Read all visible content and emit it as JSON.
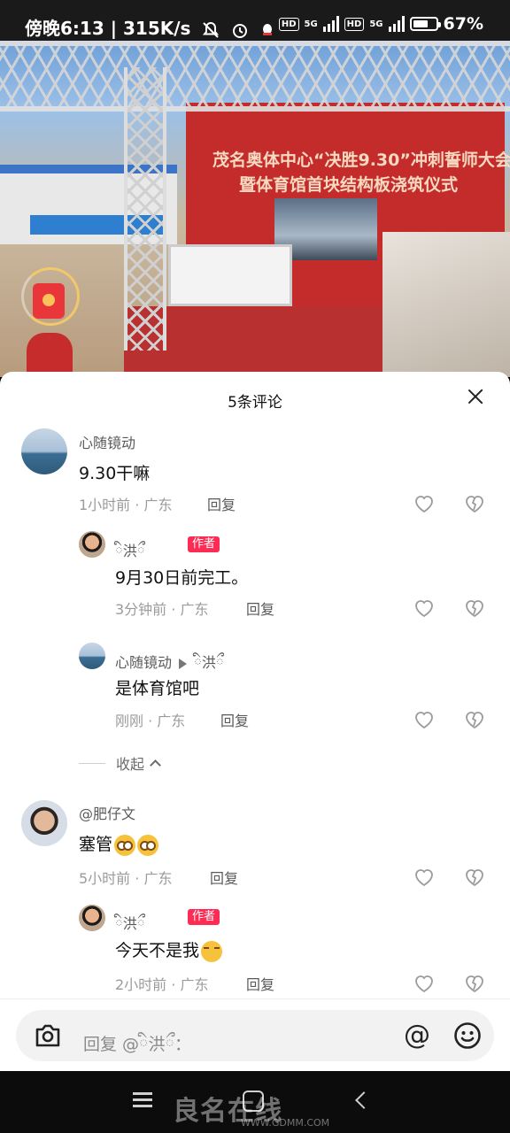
{
  "status_bar": {
    "time": "傍晚6:13",
    "speed": "315K/s",
    "network": "5G",
    "battery": "67%"
  },
  "video": {
    "banner_line1": "茂名奥体中心“决胜9.30”冲刺誓师大会",
    "banner_line2": "暨体育馆首块结构板浇筑仪式"
  },
  "sheet": {
    "title": "5条评论"
  },
  "comments": [
    {
      "user": "心随镜动",
      "text": "9.30干嘛",
      "time": "1小时前",
      "location": "广东",
      "reply_label": "回复"
    },
    {
      "user": "ི洪ྀ",
      "tag": "作者",
      "text": "9月30日前完工。",
      "time": "3分钟前",
      "location": "广东",
      "reply_label": "回复"
    },
    {
      "user": "心随镜动",
      "reply_to": "ི洪ྀ",
      "text": "是体育馆吧",
      "time": "刚刚",
      "location": "广东",
      "reply_label": "回复"
    },
    {
      "user": "@肥仔文",
      "text": "塞管",
      "time": "5小时前",
      "location": "广东",
      "reply_label": "回复"
    },
    {
      "user": "ི洪ྀ",
      "tag": "作者",
      "text": "今天不是我",
      "time": "2小时前",
      "location": "广东",
      "reply_label": "回复"
    }
  ],
  "collapse_label": "收起",
  "input": {
    "placeholder": "回复 @ི洪ྀ："
  },
  "watermark": {
    "text": "良名在线",
    "url": "WWW.GDMM.COM"
  }
}
